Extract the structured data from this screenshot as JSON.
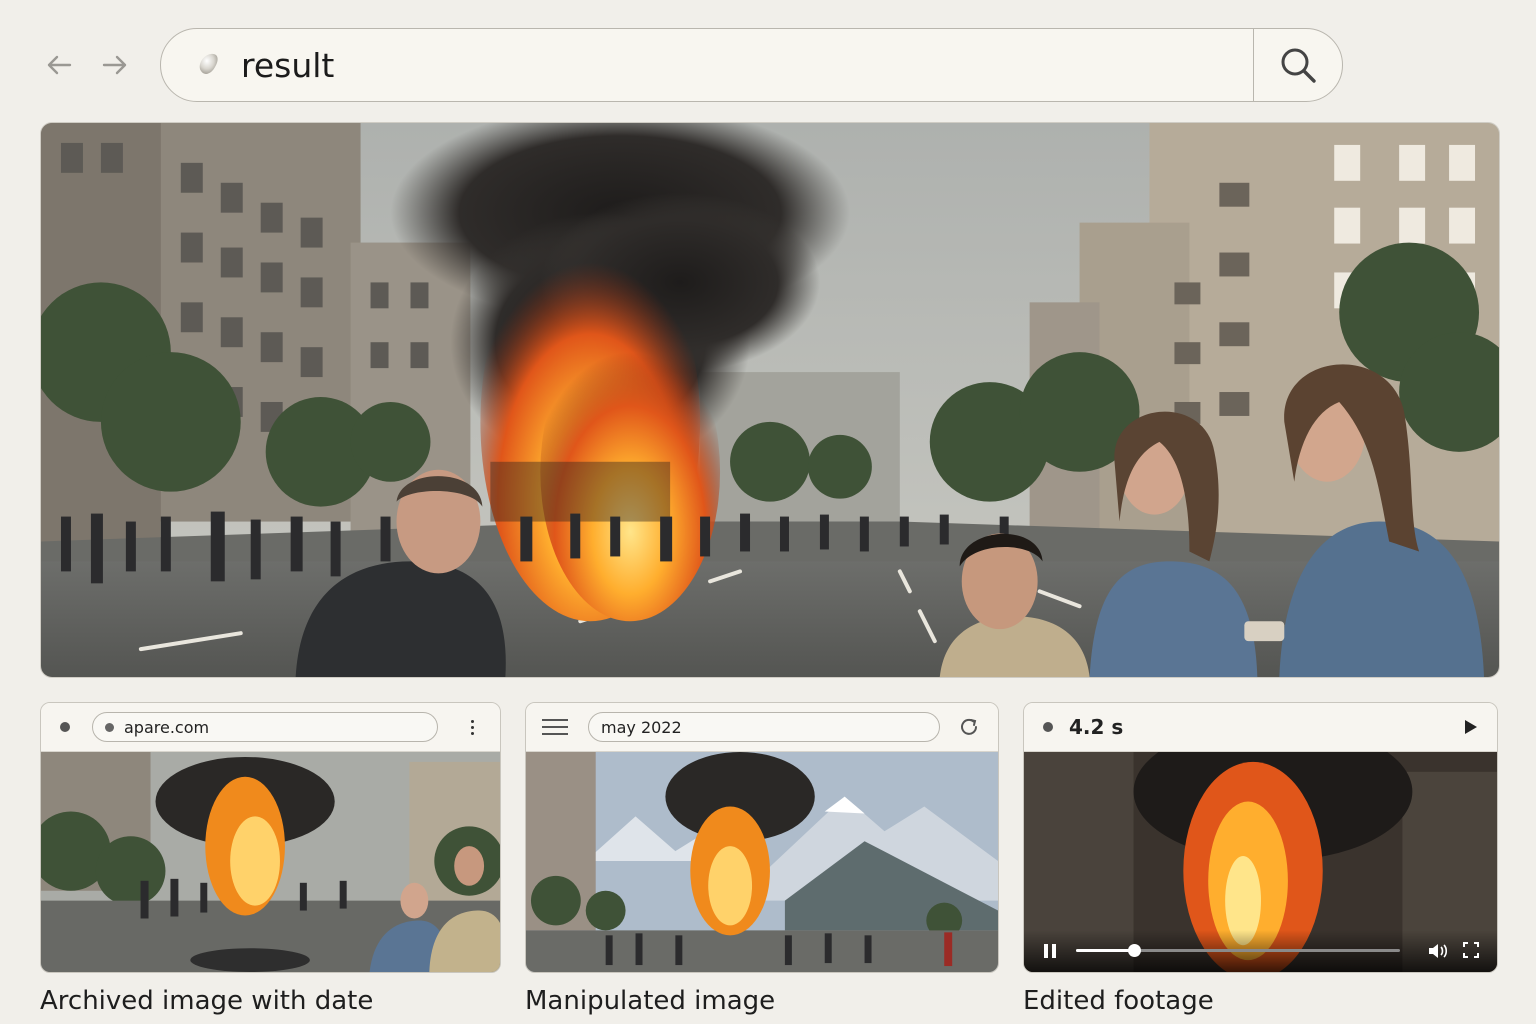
{
  "nav": {
    "back_icon": "arrow-left-icon",
    "forward_icon": "arrow-right-icon"
  },
  "search": {
    "query": "result",
    "logo_icon": "blob-logo-icon",
    "button_icon": "search-icon"
  },
  "results": [
    {
      "caption": "Archived image with date",
      "toolbar": {
        "url": "apare.com",
        "menu_icon": "kebab-menu-icon"
      }
    },
    {
      "caption": "Manipulated image",
      "toolbar": {
        "text": "may 2022",
        "menu_icon": "hamburger-icon",
        "reload_icon": "reload-icon"
      }
    },
    {
      "caption": "Edited footage",
      "toolbar": {
        "duration": "4.2 s",
        "play_icon": "play-icon"
      },
      "player": {
        "progress": 0.18,
        "pause_icon": "pause-icon",
        "volume_icon": "volume-icon",
        "fullscreen_icon": "fullscreen-icon"
      }
    }
  ],
  "colors": {
    "background": "#f1efea",
    "fire": "#f08a1c",
    "smoke": "#2a2826"
  }
}
